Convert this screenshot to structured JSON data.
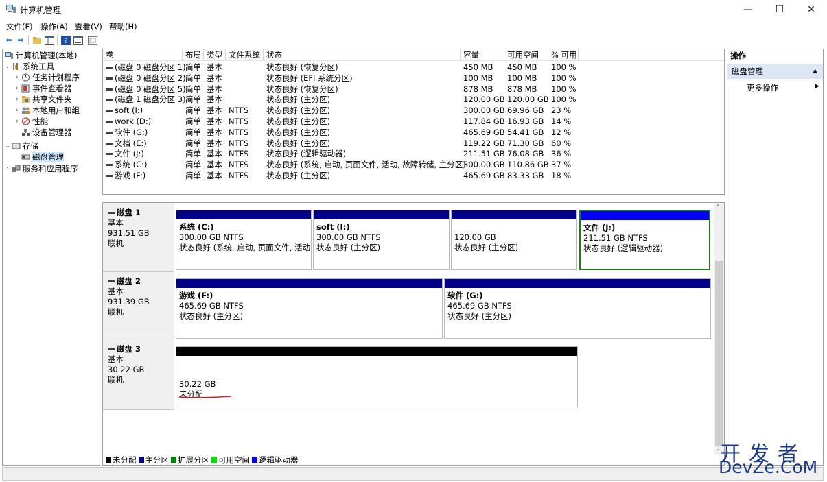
{
  "window": {
    "title": "计算机管理",
    "min": "—",
    "max": "☐",
    "close": "✕"
  },
  "menu": [
    "文件(F)",
    "操作(A)",
    "查看(V)",
    "帮助(H)"
  ],
  "tree": {
    "root": "计算机管理(本地)",
    "system_tools": "系统工具",
    "task_scheduler": "任务计划程序",
    "event_viewer": "事件查看器",
    "shared_folders": "共享文件夹",
    "local_users": "本地用户和组",
    "performance": "性能",
    "device_manager": "设备管理器",
    "storage": "存储",
    "disk_management": "磁盘管理",
    "services": "服务和应用程序"
  },
  "volume_table": {
    "headers": [
      "卷",
      "布局",
      "类型",
      "文件系统",
      "状态",
      "容量",
      "可用空间",
      "% 可用"
    ],
    "rows": [
      [
        "(磁盘 0 磁盘分区 1)",
        "简单",
        "基本",
        "",
        "状态良好 (恢复分区)",
        "450 MB",
        "450 MB",
        "100 %"
      ],
      [
        "(磁盘 0 磁盘分区 2)",
        "简单",
        "基本",
        "",
        "状态良好 (EFI 系统分区)",
        "100 MB",
        "100 MB",
        "100 %"
      ],
      [
        "(磁盘 0 磁盘分区 5)",
        "简单",
        "基本",
        "",
        "状态良好 (恢复分区)",
        "878 MB",
        "878 MB",
        "100 %"
      ],
      [
        "(磁盘 1 磁盘分区 3)",
        "简单",
        "基本",
        "",
        "状态良好 (主分区)",
        "120.00 GB",
        "120.00 GB",
        "100 %"
      ],
      [
        "soft (I:)",
        "简单",
        "基本",
        "NTFS",
        "状态良好 (主分区)",
        "300.00 GB",
        "69.96 GB",
        "23 %"
      ],
      [
        "work (D:)",
        "简单",
        "基本",
        "NTFS",
        "状态良好 (主分区)",
        "117.84 GB",
        "16.93 GB",
        "14 %"
      ],
      [
        "软件 (G:)",
        "简单",
        "基本",
        "NTFS",
        "状态良好 (主分区)",
        "465.69 GB",
        "54.41 GB",
        "12 %"
      ],
      [
        "文档 (E:)",
        "简单",
        "基本",
        "NTFS",
        "状态良好 (主分区)",
        "119.22 GB",
        "71.30 GB",
        "60 %"
      ],
      [
        "文件 (J:)",
        "简单",
        "基本",
        "NTFS",
        "状态良好 (逻辑驱动器)",
        "211.51 GB",
        "76.08 GB",
        "36 %"
      ],
      [
        "系统 (C:)",
        "简单",
        "基本",
        "NTFS",
        "状态良好 (系统, 启动, 页面文件, 活动, 故障转储, 主分区)",
        "300.00 GB",
        "110.86 GB",
        "37 %"
      ],
      [
        "游戏 (F:)",
        "简单",
        "基本",
        "NTFS",
        "状态良好 (主分区)",
        "465.69 GB",
        "83.33 GB",
        "18 %"
      ]
    ]
  },
  "disks": [
    {
      "name": "磁盘 1",
      "type": "基本",
      "size": "931.51 GB",
      "status": "联机",
      "partitions": [
        {
          "name": "系统 (C:)",
          "size": "300.00 GB NTFS",
          "status": "状态良好 (系统, 启动, 页面文件, 活动,",
          "bar": "#00008b"
        },
        {
          "name": "soft (I:)",
          "size": "300.00 GB NTFS",
          "status": "状态良好 (主分区)",
          "bar": "#00008b"
        },
        {
          "name": "",
          "size": "120.00 GB",
          "status": "状态良好 (主分区)",
          "bar": "#00008b"
        },
        {
          "name": "文件 (J:)",
          "size": "211.51 GB NTFS",
          "status": "状态良好 (逻辑驱动器)",
          "bar": "#0000ff",
          "selected": true
        }
      ]
    },
    {
      "name": "磁盘 2",
      "type": "基本",
      "size": "931.39 GB",
      "status": "联机",
      "partitions": [
        {
          "name": "游戏 (F:)",
          "size": "465.69 GB NTFS",
          "status": "状态良好 (主分区)",
          "bar": "#00008b"
        },
        {
          "name": "软件 (G:)",
          "size": "465.69 GB NTFS",
          "status": "状态良好 (主分区)",
          "bar": "#00008b"
        }
      ]
    },
    {
      "name": "磁盘 3",
      "type": "基本",
      "size": "30.22 GB",
      "status": "联机",
      "partitions": [
        {
          "name": "",
          "size": "30.22 GB",
          "status": "未分配",
          "bar": "#000000"
        }
      ]
    }
  ],
  "legend": [
    {
      "label": "未分配",
      "color": "#000000"
    },
    {
      "label": "主分区",
      "color": "#00008b"
    },
    {
      "label": "扩展分区",
      "color": "#008000"
    },
    {
      "label": "可用空间",
      "color": "#00e000"
    },
    {
      "label": "逻辑驱动器",
      "color": "#0000ff"
    }
  ],
  "actions": {
    "header": "操作",
    "section": "磁盘管理",
    "more": "更多操作"
  },
  "watermark": {
    "line1": "开发者",
    "line2": "DevZe.CoM"
  }
}
